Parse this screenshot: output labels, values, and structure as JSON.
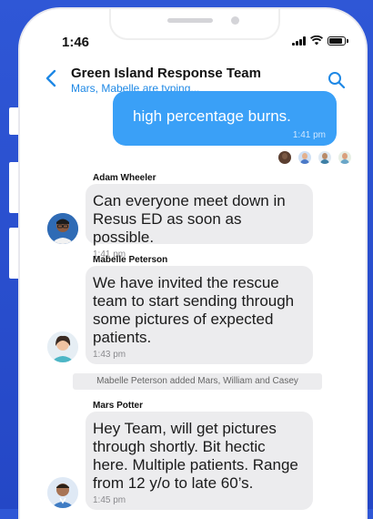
{
  "status_bar": {
    "time": "1:46"
  },
  "header": {
    "title": "Green Island Response Team",
    "subtitle": "Mars, Mabelle are typing..."
  },
  "outgoing": {
    "text": "high percentage burns.",
    "time": "1:41 pm"
  },
  "messages": [
    {
      "sender": "Adam Wheeler",
      "text": "Can everyone meet down in\nResus ED as soon as possible.",
      "time": "1:41 pm"
    },
    {
      "sender": "Mabelle Peterson",
      "text": "We have invited the rescue\nteam to start sending through\nsome pictures of expected\npatients.",
      "time": "1:43 pm"
    },
    {
      "sender": "Mars Potter",
      "text": "Hey Team, will get pictures\nthrough shortly. Bit hectic\nhere. Multiple patients. Range\nfrom 12 y/o to late 60’s.",
      "time": "1:45 pm"
    }
  ],
  "system_message": "Mabelle Peterson added Mars, William and Casey",
  "icons": {
    "back": "chevron-left-icon",
    "search": "search-icon"
  },
  "colors": {
    "accent": "#1e88e5",
    "outgoing_bubble": "#3aa0f7",
    "incoming_bubble": "#ececee",
    "background": "#2447c6"
  }
}
